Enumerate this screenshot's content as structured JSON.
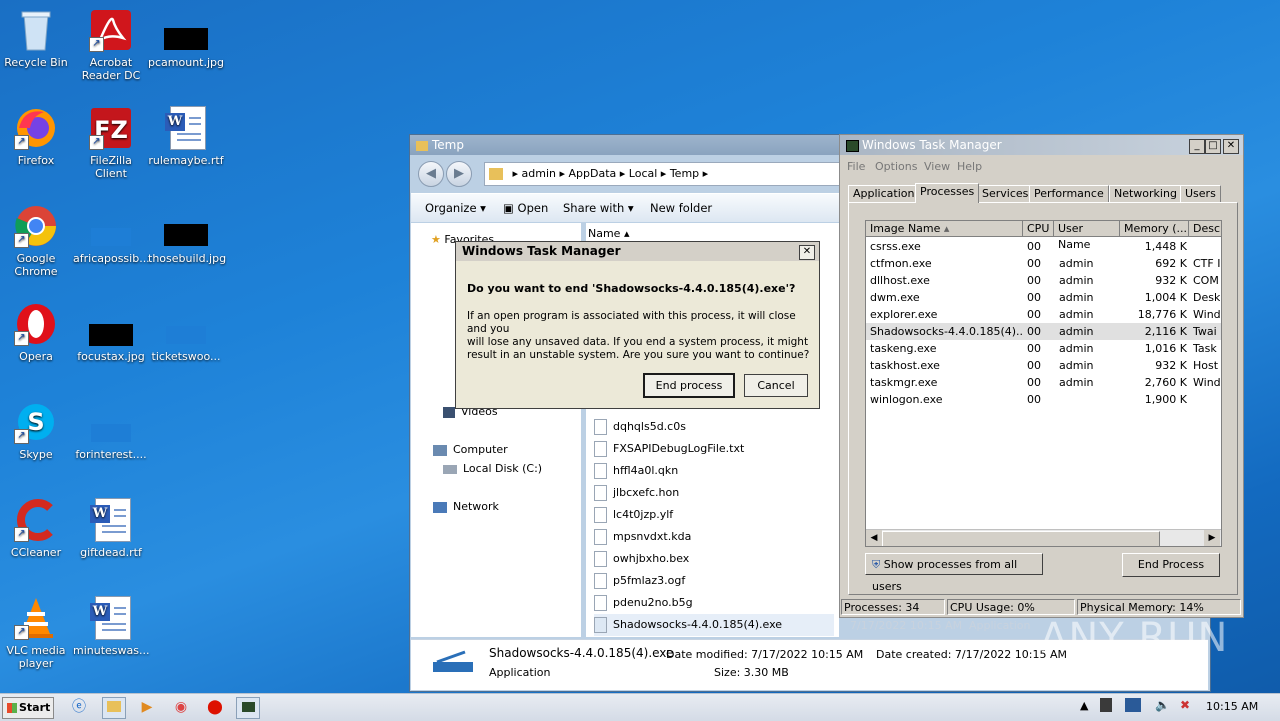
{
  "desktop": {
    "icons": [
      {
        "label": "Recycle Bin"
      },
      {
        "label": "Acrobat Reader DC"
      },
      {
        "label": "pcamount.jpg"
      },
      {
        "label": "Firefox"
      },
      {
        "label": "FileZilla Client"
      },
      {
        "label": "rulemaybe.rtf"
      },
      {
        "label": "Google Chrome"
      },
      {
        "label": "africapossib..."
      },
      {
        "label": "thosebuild.jpg"
      },
      {
        "label": "Opera"
      },
      {
        "label": "focustax.jpg"
      },
      {
        "label": "ticketswoo..."
      },
      {
        "label": "Skype"
      },
      {
        "label": "forinterest...."
      },
      {
        "label": "CCleaner"
      },
      {
        "label": "giftdead.rtf"
      },
      {
        "label": "VLC media player"
      },
      {
        "label": "minuteswas..."
      }
    ]
  },
  "explorer": {
    "title": "Temp",
    "breadcrumb": [
      "admin",
      "AppData",
      "Local",
      "Temp"
    ],
    "toolbar": {
      "organize": "Organize",
      "open": "Open",
      "share_with": "Share with",
      "new_folder": "New folder"
    },
    "nav": {
      "favorites": "Favorites",
      "videos": "Videos",
      "computer": "Computer",
      "local_disk": "Local Disk (C:)",
      "network": "Network"
    },
    "column_name": "Name",
    "files": [
      "dqhqls5d.c0s",
      "FXSAPIDebugLogFile.txt",
      "hffl4a0l.qkn",
      "jlbcxefc.hon",
      "lc4t0jzp.ylf",
      "mpsnvdxt.kda",
      "owhjbxho.bex",
      "p5fmlaz3.ogf",
      "pdenu2no.b5g",
      "Shadowsocks-4.4.0.185(4).exe"
    ],
    "selected_row_extra": {
      "date": "7/17/2022 10:15 AM",
      "type": "Application"
    },
    "details": {
      "name": "Shadowsocks-4.4.0.185(4).exe",
      "type": "Application",
      "date_modified_label": "Date modified:",
      "date_modified": "7/17/2022 10:15 AM",
      "date_created_label": "Date created:",
      "date_created": "7/17/2022 10:15 AM",
      "size_label": "Size:",
      "size": "3.30 MB"
    }
  },
  "taskmgr": {
    "title": "Windows Task Manager",
    "menu": [
      "File",
      "Options",
      "View",
      "Help"
    ],
    "tabs": [
      "Applications",
      "Processes",
      "Services",
      "Performance",
      "Networking",
      "Users"
    ],
    "columns": [
      "Image Name",
      "CPU",
      "User Name",
      "Memory (...",
      "Desc"
    ],
    "processes": [
      {
        "name": "csrss.exe",
        "cpu": "00",
        "user": "",
        "mem": "1,448 K",
        "desc": ""
      },
      {
        "name": "ctfmon.exe",
        "cpu": "00",
        "user": "admin",
        "mem": "692 K",
        "desc": "CTF I"
      },
      {
        "name": "dllhost.exe",
        "cpu": "00",
        "user": "admin",
        "mem": "932 K",
        "desc": "COM"
      },
      {
        "name": "dwm.exe",
        "cpu": "00",
        "user": "admin",
        "mem": "1,004 K",
        "desc": "Desk"
      },
      {
        "name": "explorer.exe",
        "cpu": "00",
        "user": "admin",
        "mem": "18,776 K",
        "desc": "Wind"
      },
      {
        "name": "Shadowsocks-4.4.0.185(4)....",
        "cpu": "00",
        "user": "admin",
        "mem": "2,116 K",
        "desc": "Twai"
      },
      {
        "name": "taskeng.exe",
        "cpu": "00",
        "user": "admin",
        "mem": "1,016 K",
        "desc": "Task"
      },
      {
        "name": "taskhost.exe",
        "cpu": "00",
        "user": "admin",
        "mem": "932 K",
        "desc": "Host"
      },
      {
        "name": "taskmgr.exe",
        "cpu": "00",
        "user": "admin",
        "mem": "2,760 K",
        "desc": "Wind"
      },
      {
        "name": "winlogon.exe",
        "cpu": "00",
        "user": "",
        "mem": "1,900 K",
        "desc": ""
      }
    ],
    "show_all_button": "Show processes from all users",
    "end_process_button": "End Process",
    "status": {
      "processes": "Processes: 34",
      "cpu": "CPU Usage: 0%",
      "memory": "Physical Memory: 14%"
    }
  },
  "dialog": {
    "title": "Windows Task Manager",
    "question": "Do you want to end 'Shadowsocks-4.4.0.185(4).exe'?",
    "body_line1": "If an open program is associated with this process, it will close and you",
    "body_line2": "will lose any unsaved data. If you end a system process, it might",
    "body_line3": "result in an unstable system. Are you sure you want to continue?",
    "end_process": "End process",
    "cancel": "Cancel"
  },
  "taskbar": {
    "start": "Start",
    "clock": "10:15 AM"
  },
  "watermark": "ANY RUN"
}
